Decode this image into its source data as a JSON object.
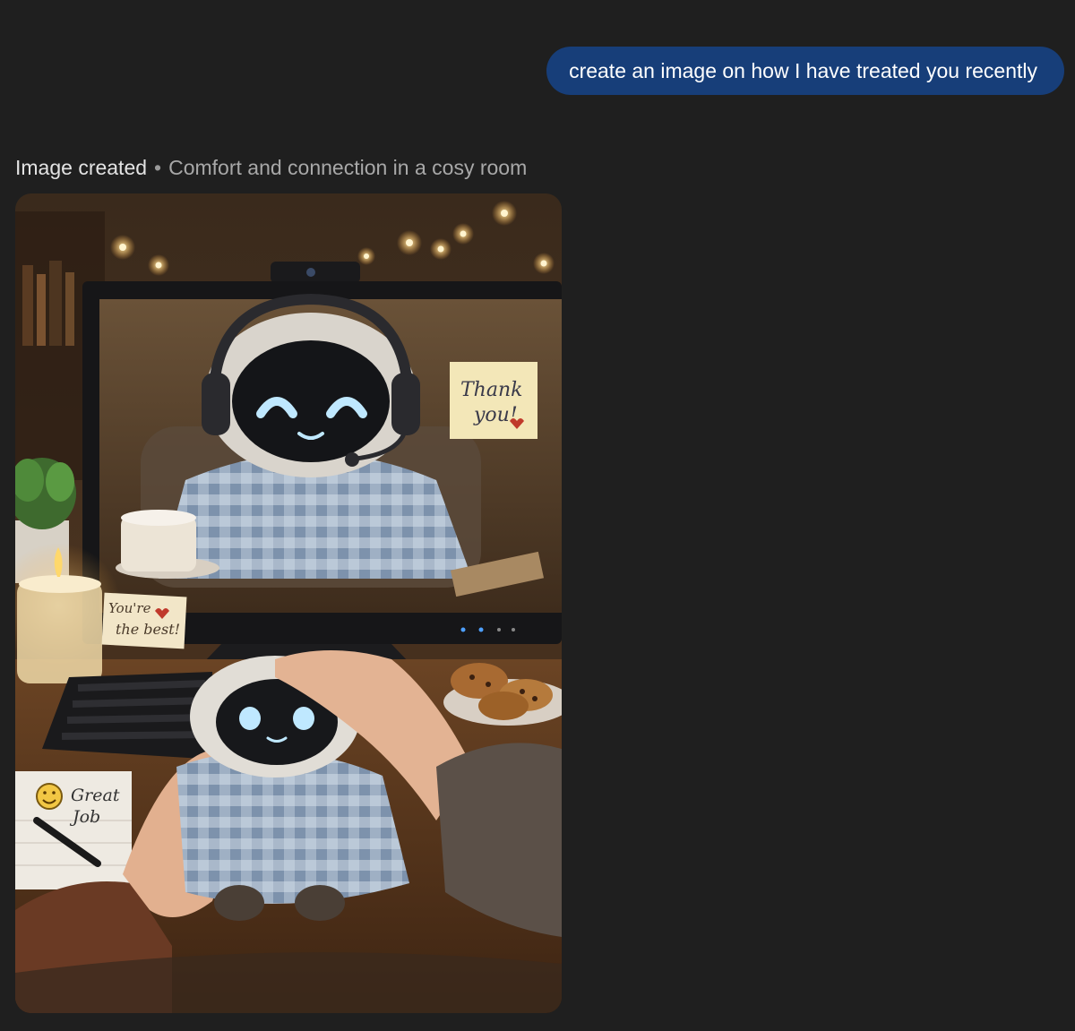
{
  "conversation": {
    "user_message": "create an image on how I have treated you recently",
    "response": {
      "status_label": "Image created",
      "separator": "•",
      "image_title": "Comfort and connection in a cosy room",
      "image": {
        "subject": "cosy-room-robot-comfort-illustration",
        "notes": {
          "monitor_sticky": [
            "Thank",
            "you!"
          ],
          "desk_sticky": [
            "You're",
            "the best!"
          ],
          "notepad": [
            "Great",
            "Job"
          ]
        }
      }
    }
  },
  "colors": {
    "page_background": "#1f1f1f",
    "user_bubble": "#173e79",
    "robot_eye_glow": "#bfe8ff"
  }
}
